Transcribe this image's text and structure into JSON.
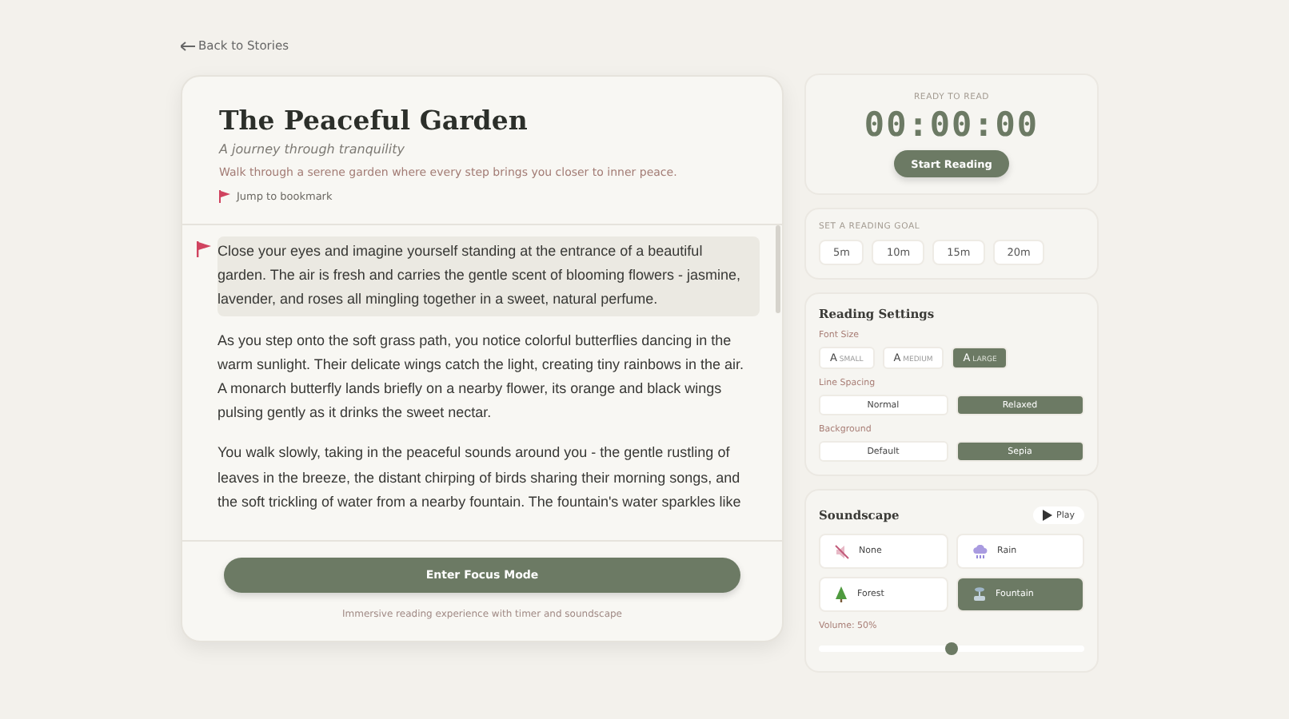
{
  "back_link": {
    "label": "Back to Stories"
  },
  "story": {
    "title": "The Peaceful Garden",
    "subtitle": "A journey through tranquility",
    "description": "Walk through a serene garden where every step brings you closer to inner peace.",
    "bookmark_link": "Jump to bookmark",
    "paragraphs": [
      {
        "text": "Close your eyes and imagine yourself standing at the entrance of a beautiful garden. The air is fresh and carries the gentle scent of blooming flowers - jasmine, lavender, and roses all mingling together in a sweet, natural perfume.",
        "bookmarked": true
      },
      {
        "text": "As you step onto the soft grass path, you notice colorful butterflies dancing in the warm sunlight. Their delicate wings catch the light, creating tiny rainbows in the air. A monarch butterfly lands briefly on a nearby flower, its orange and black wings pulsing gently as it drinks the sweet nectar.",
        "bookmarked": false
      },
      {
        "text": "You walk slowly, taking in the peaceful sounds around you - the gentle rustling of leaves in the breeze, the distant chirping of birds sharing their morning songs, and the soft trickling of water from a nearby fountain. The fountain's water sparkles like",
        "bookmarked": false
      }
    ],
    "focus_button": "Enter Focus Mode",
    "focus_caption": "Immersive reading experience with timer and soundscape"
  },
  "timer": {
    "status": "READY TO READ",
    "time": "00:00:00",
    "button": "Start Reading"
  },
  "goal": {
    "label": "SET A READING GOAL",
    "options": [
      {
        "label": "5m",
        "selected": false
      },
      {
        "label": "10m",
        "selected": false
      },
      {
        "label": "15m",
        "selected": false
      },
      {
        "label": "20m",
        "selected": false
      }
    ]
  },
  "settings": {
    "title": "Reading Settings",
    "font_size": {
      "label": "Font Size",
      "options": [
        {
          "letter": "A",
          "label": "SMALL",
          "selected": false
        },
        {
          "letter": "A",
          "label": "MEDIUM",
          "selected": false
        },
        {
          "letter": "A",
          "label": "LARGE",
          "selected": true
        }
      ]
    },
    "line_spacing": {
      "label": "Line Spacing",
      "options": [
        {
          "label": "Normal",
          "selected": false
        },
        {
          "label": "Relaxed",
          "selected": true
        }
      ]
    },
    "background": {
      "label": "Background",
      "options": [
        {
          "label": "Default",
          "selected": false
        },
        {
          "label": "Sepia",
          "selected": true
        }
      ]
    }
  },
  "soundscape": {
    "title": "Soundscape",
    "play_button": "Play",
    "options": [
      {
        "kind": "none",
        "label": "None",
        "selected": false
      },
      {
        "kind": "rain",
        "label": "Rain",
        "selected": false
      },
      {
        "kind": "forest",
        "label": "Forest",
        "selected": false
      },
      {
        "kind": "fountain",
        "label": "Fountain",
        "selected": true
      }
    ],
    "volume_label": "Volume: 50%",
    "volume": {
      "level": 0.5
    }
  }
}
